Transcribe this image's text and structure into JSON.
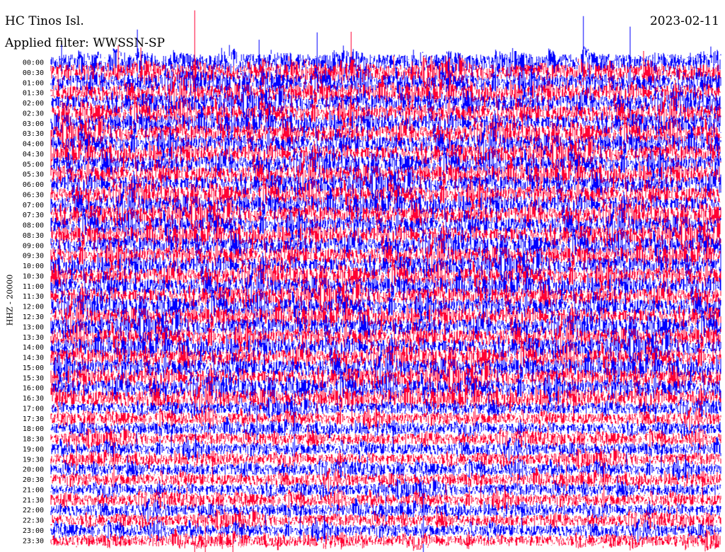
{
  "station": "HC Tinos Isl.",
  "date": "2023-02-11",
  "filter": "Applied filter: WWSSN-SP",
  "channel_label": "HHZ - 20000",
  "trace_colors": [
    "#0000ff",
    "#ff0033"
  ],
  "time_labels": [
    "00:00",
    "00:30",
    "01:00",
    "01:30",
    "02:00",
    "02:30",
    "03:00",
    "03:30",
    "04:00",
    "04:30",
    "05:00",
    "05:30",
    "06:00",
    "06:30",
    "07:00",
    "07:30",
    "08:00",
    "08:30",
    "09:00",
    "09:30",
    "10:00",
    "10:30",
    "11:00",
    "11:30",
    "12:00",
    "12:30",
    "13:00",
    "13:30",
    "14:00",
    "14:30",
    "15:00",
    "15:30",
    "16:00",
    "16:30",
    "17:00",
    "17:30",
    "18:00",
    "18:30",
    "19:00",
    "19:30",
    "20:00",
    "20:30",
    "21:00",
    "21:30",
    "22:00",
    "22:30",
    "23:00",
    "23:30"
  ]
}
